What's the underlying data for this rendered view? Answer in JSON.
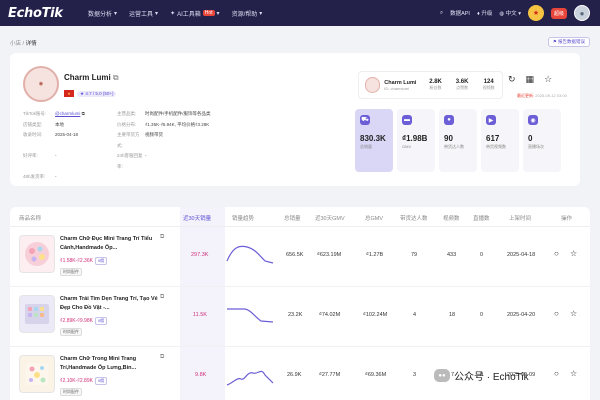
{
  "nav": {
    "logo": "EchoTik",
    "menu": [
      "数据分析",
      "运营工具",
      "AI工具箱",
      "资源/帮助"
    ],
    "hot": "Hot",
    "api": "数据API",
    "upgrade": "升级",
    "lang": "中文",
    "vip": "超级",
    "flag_icon": "china-flag-icon"
  },
  "breadcrumb": {
    "root": "小店",
    "sep": "/",
    "current": "详情"
  },
  "report_button": "报告数据错误",
  "shop": {
    "name": "Charm Lumi",
    "rating": "4.7 / 5.0",
    "rating_extra": "(50+)",
    "info": [
      {
        "k1": "TikTok账号:",
        "v1": "@charmlumi",
        "k2": "主营品类:",
        "v2": "时尚配件/手机配件/服饰等各品类"
      },
      {
        "k1": "店铺类型:",
        "v1": "本地",
        "k2": "价格分布:",
        "v2": "₫1.35K-₫5.94K, 平均价格₫3.28K"
      },
      {
        "k1": "收录时间:",
        "v1": "2025-04-18",
        "k2": "主要带货方式:",
        "v2": "视频带货"
      },
      {
        "k1": "好评率:",
        "v1": "-",
        "k2": "24h客服回复率:",
        "v2": "-"
      },
      {
        "k1": "48h发货率:",
        "v1": "-",
        "k2": "",
        "v2": ""
      }
    ]
  },
  "mini": {
    "name": "Charm Lumi",
    "handle": "ID: charmlumi",
    "stats": [
      {
        "v": "2.8K",
        "l": "粉丝数"
      },
      {
        "v": "3.6K",
        "l": "点赞数"
      },
      {
        "v": "124",
        "l": "视频数"
      }
    ]
  },
  "update": {
    "label": "最近更新:",
    "time": "2025-09-12 03:00"
  },
  "metrics": [
    {
      "value": "830.3K",
      "label": "总销量",
      "icon": "cart-icon"
    },
    {
      "value": "₫1.98B",
      "label": "GMV",
      "icon": "money-icon"
    },
    {
      "value": "90",
      "label": "带货达人数",
      "icon": "person-icon"
    },
    {
      "value": "617",
      "label": "带货视频数",
      "icon": "video-icon"
    },
    {
      "value": "0",
      "label": "直播场次",
      "icon": "live-icon"
    }
  ],
  "table": {
    "headers": [
      "商品名称",
      "近30天销量",
      "销量趋势",
      "总销量",
      "近30天GMV",
      "总GMV",
      "带货达人数",
      "视频数",
      "直播数",
      "上架时间",
      "操作"
    ],
    "rows": [
      {
        "title": "Charm Chữ Đục Mini Trang Trí Tiểu Cảnh,Handmade Ốp...",
        "price": "₫1.58K-₫2.36K",
        "tag": "0佣",
        "cat": "时尚配件",
        "sales30": "297.3K",
        "total": "656.5K",
        "gmv30": "₫623.19M",
        "gmv": "₫1.27B",
        "creators": "79",
        "videos": "433",
        "lives": "0",
        "date": "2025-04-18"
      },
      {
        "title": "Charm Trái Tim Dẹn Trang Trí, Tạo Vẻ Đẹp Cho Đồ Vật -...",
        "price": "₫2.89K-₫9.98K",
        "tag": "0佣",
        "cat": "时尚配件",
        "sales30": "11.5K",
        "total": "23.2K",
        "gmv30": "₫74.02M",
        "gmv": "₫102.24M",
        "creators": "4",
        "videos": "18",
        "lives": "0",
        "date": "2025-04-20"
      },
      {
        "title": "Charm Chữ Trong Mini Trang Trí,Handmade Ốp Lưng,Bin...",
        "price": "₫2.10K-₫2.89K",
        "tag": "0佣",
        "cat": "时尚配件",
        "sales30": "9.8K",
        "total": "26.9K",
        "gmv30": "₫27.77M",
        "gmv": "₫69.36M",
        "creators": "3",
        "videos": "7",
        "lives": "0",
        "date": "2025-09-09"
      }
    ]
  },
  "watermark": "公众号 · EchoTik"
}
